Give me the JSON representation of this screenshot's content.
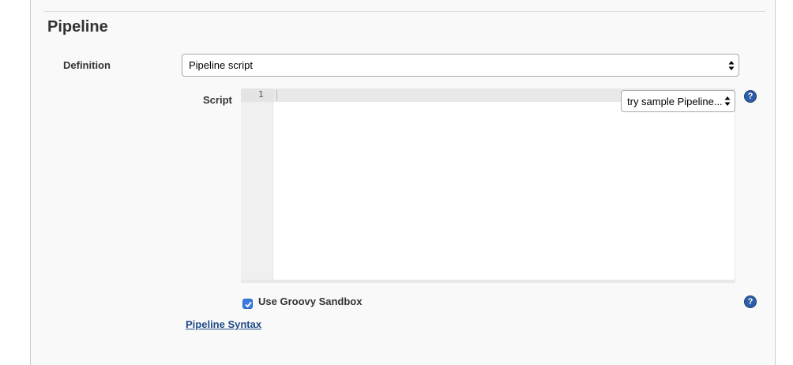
{
  "section": {
    "title": "Pipeline"
  },
  "definition": {
    "label": "Definition",
    "selected": "Pipeline script"
  },
  "script": {
    "label": "Script",
    "line_numbers": [
      "1"
    ],
    "sample_selected": "try sample Pipeline..."
  },
  "sandbox": {
    "label": "Use Groovy Sandbox",
    "checked": true
  },
  "links": {
    "pipeline_syntax": "Pipeline Syntax"
  },
  "icons": {
    "help": "?"
  },
  "colors": {
    "link": "#204a87",
    "help_icon": "#2e5ea8",
    "checkbox": "#3a7be0"
  }
}
